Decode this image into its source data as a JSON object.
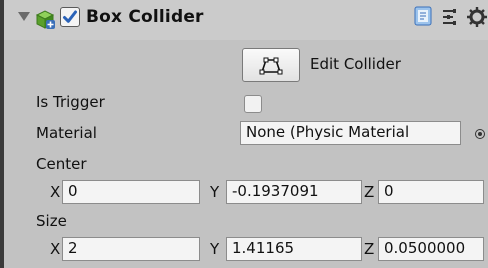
{
  "component": {
    "title": "Box Collider",
    "enabled": true,
    "icon": "box-collider-icon"
  },
  "header_icons": [
    "help-icon",
    "preset-icon",
    "gear-icon"
  ],
  "edit_collider": {
    "label": "Edit Collider",
    "icon": "edit-collider-icon"
  },
  "fields": {
    "is_trigger": {
      "label": "Is Trigger",
      "checked": false
    },
    "material": {
      "label": "Material",
      "value": "None (Physic Material"
    },
    "center": {
      "label": "Center",
      "x_label": "X",
      "y_label": "Y",
      "z_label": "Z",
      "x": "0",
      "y": "-0.1937091",
      "z": "0"
    },
    "size": {
      "label": "Size",
      "x_label": "X",
      "y_label": "Y",
      "z_label": "Z",
      "x": "2",
      "y": "1.41165",
      "z": "0.0500000 "
    }
  },
  "colors": {
    "background": "#c2c2c2",
    "field": "#f4f4f4",
    "check": "#2a62b8",
    "icon_green": "#5aa02c",
    "icon_blue": "#3a6fb8"
  }
}
